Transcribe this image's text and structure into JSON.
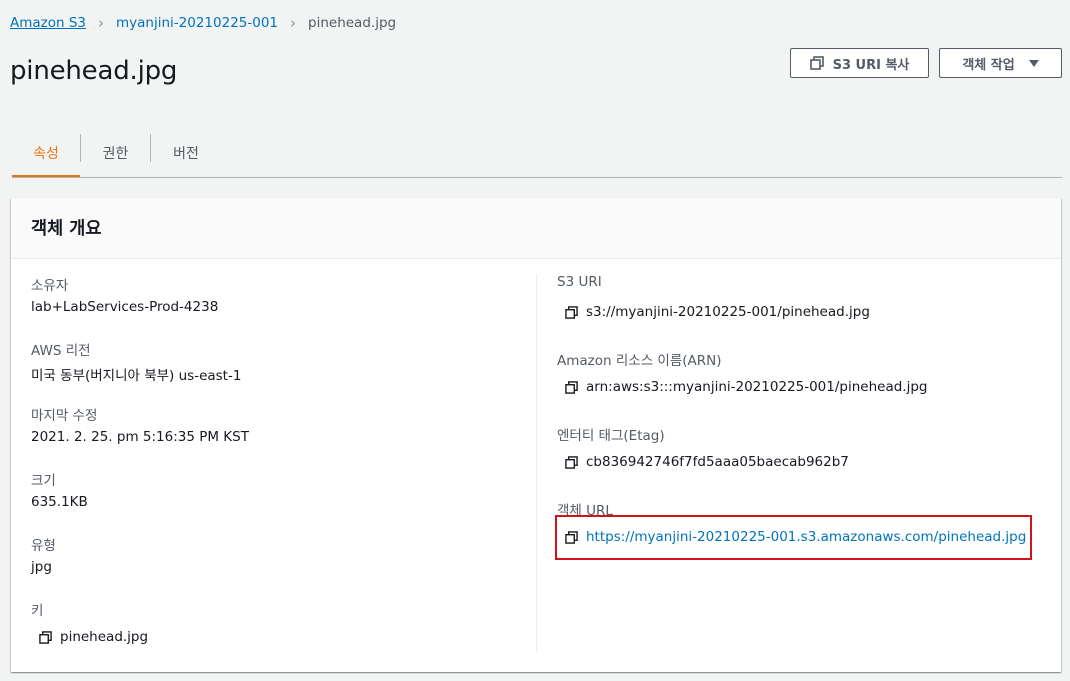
{
  "breadcrumb": {
    "items": [
      "Amazon S3",
      "myanjini-20210225-001",
      "pinehead.jpg"
    ]
  },
  "page": {
    "title": "pinehead.jpg"
  },
  "header_buttons": {
    "copy_uri_label": "S3 URI 복사",
    "actions_label": "객체 작업"
  },
  "tabs": [
    {
      "label": "속성",
      "active": true
    },
    {
      "label": "권한",
      "active": false
    },
    {
      "label": "버전",
      "active": false
    }
  ],
  "overview": {
    "title": "객체 개요",
    "left": [
      {
        "label": "소유자",
        "value": "lab+LabServices-Prod-4238"
      },
      {
        "label": "AWS 리전",
        "value": "미국 동부(버지니아 북부) us-east-1"
      },
      {
        "label": "마지막 수정",
        "value": "2021. 2. 25. pm 5:16:35 PM KST"
      },
      {
        "label": "크기",
        "value": "635.1KB"
      },
      {
        "label": "유형",
        "value": "jpg"
      },
      {
        "label": "키",
        "value": "pinehead.jpg"
      }
    ],
    "right": [
      {
        "label": "S3 URI",
        "value": "s3://myanjini-20210225-001/pinehead.jpg"
      },
      {
        "label": "Amazon 리소스 이름(ARN)",
        "value": "arn:aws:s3:::myanjini-20210225-001/pinehead.jpg"
      },
      {
        "label": "엔터티 태그(Etag)",
        "value": "cb836942746f7fd5aaa05baecab962b7"
      },
      {
        "label": "객체 URL",
        "value": "https://myanjini-20210225-001.s3.amazonaws.com/pinehead.jpg"
      }
    ]
  },
  "icons": {
    "copy": "copy-icon",
    "dropdown": "caret-down-icon",
    "separator": "chevron-right-icon"
  },
  "colors": {
    "link": "#0073bb",
    "active_tab": "#ec7211",
    "highlight": "#d0121a"
  }
}
